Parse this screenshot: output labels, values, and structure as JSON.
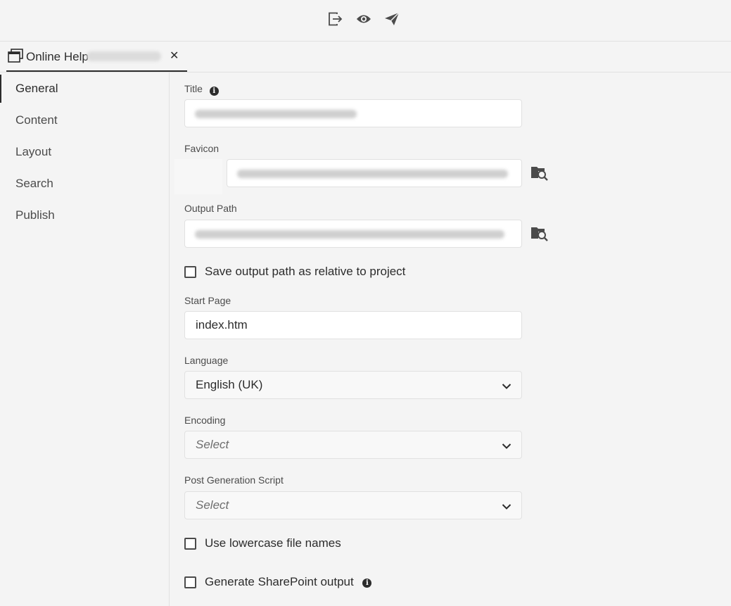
{
  "toolbar": {
    "icons": [
      "export-icon",
      "preview-icon",
      "publish-send-icon"
    ]
  },
  "tab": {
    "label": "Online Help",
    "close_glyph": "✕"
  },
  "sidebar": {
    "items": [
      {
        "label": "General",
        "active": true
      },
      {
        "label": "Content",
        "active": false
      },
      {
        "label": "Layout",
        "active": false
      },
      {
        "label": "Search",
        "active": false
      },
      {
        "label": "Publish",
        "active": false
      }
    ]
  },
  "form": {
    "title": {
      "label": "Title",
      "info_glyph": "i"
    },
    "favicon": {
      "label": "Favicon"
    },
    "output_path": {
      "label": "Output Path"
    },
    "save_relative": {
      "label": "Save output path as relative to project",
      "checked": false
    },
    "start_page": {
      "label": "Start Page",
      "value": "index.htm"
    },
    "language": {
      "label": "Language",
      "value": "English (UK)"
    },
    "encoding": {
      "label": "Encoding",
      "placeholder": "Select"
    },
    "post_script": {
      "label": "Post Generation Script",
      "placeholder": "Select"
    },
    "lowercase": {
      "label": "Use lowercase file names",
      "checked": false
    },
    "sharepoint": {
      "label": "Generate SharePoint output",
      "checked": false,
      "info_glyph": "i"
    }
  },
  "colors": {
    "background": "#f4f4f4",
    "text": "#2c2c2c",
    "border": "#e1e1e1",
    "input_bg": "#ffffff"
  }
}
